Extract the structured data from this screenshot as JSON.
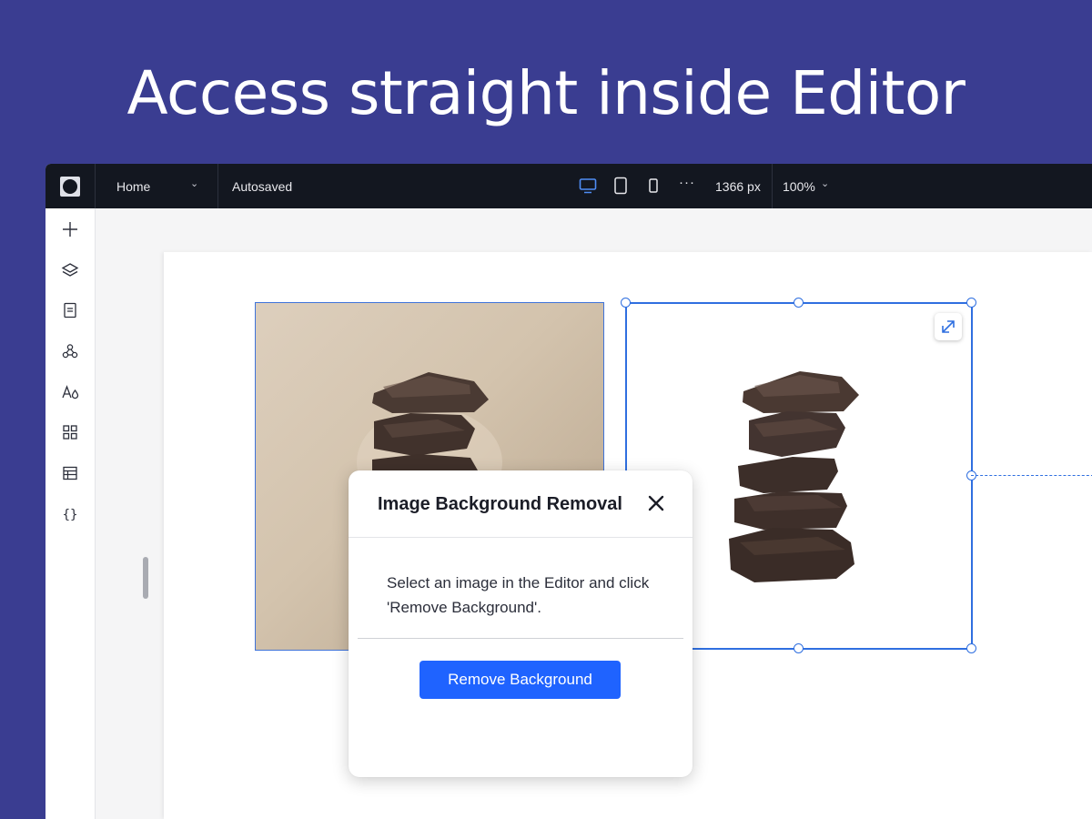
{
  "headline": "Access straight inside Editor",
  "topbar": {
    "page_name": "Home",
    "save_status": "Autosaved",
    "width_readout": "1366 px",
    "zoom": "100%",
    "more": "···"
  },
  "sidebar": {
    "icons": [
      "add-icon",
      "layers-icon",
      "pages-icon",
      "apps-icon",
      "theme-icon",
      "grid-icon",
      "table-icon",
      "code-icon"
    ]
  },
  "dialog": {
    "title": "Image Background Removal",
    "message": "Select an image in the Editor and click 'Remove Background'.",
    "button_label": "Remove Background"
  },
  "colors": {
    "brand_background": "#3a3d91",
    "topbar": "#131720",
    "selection": "#2f6fe0",
    "primary_button": "#1f63ff"
  }
}
